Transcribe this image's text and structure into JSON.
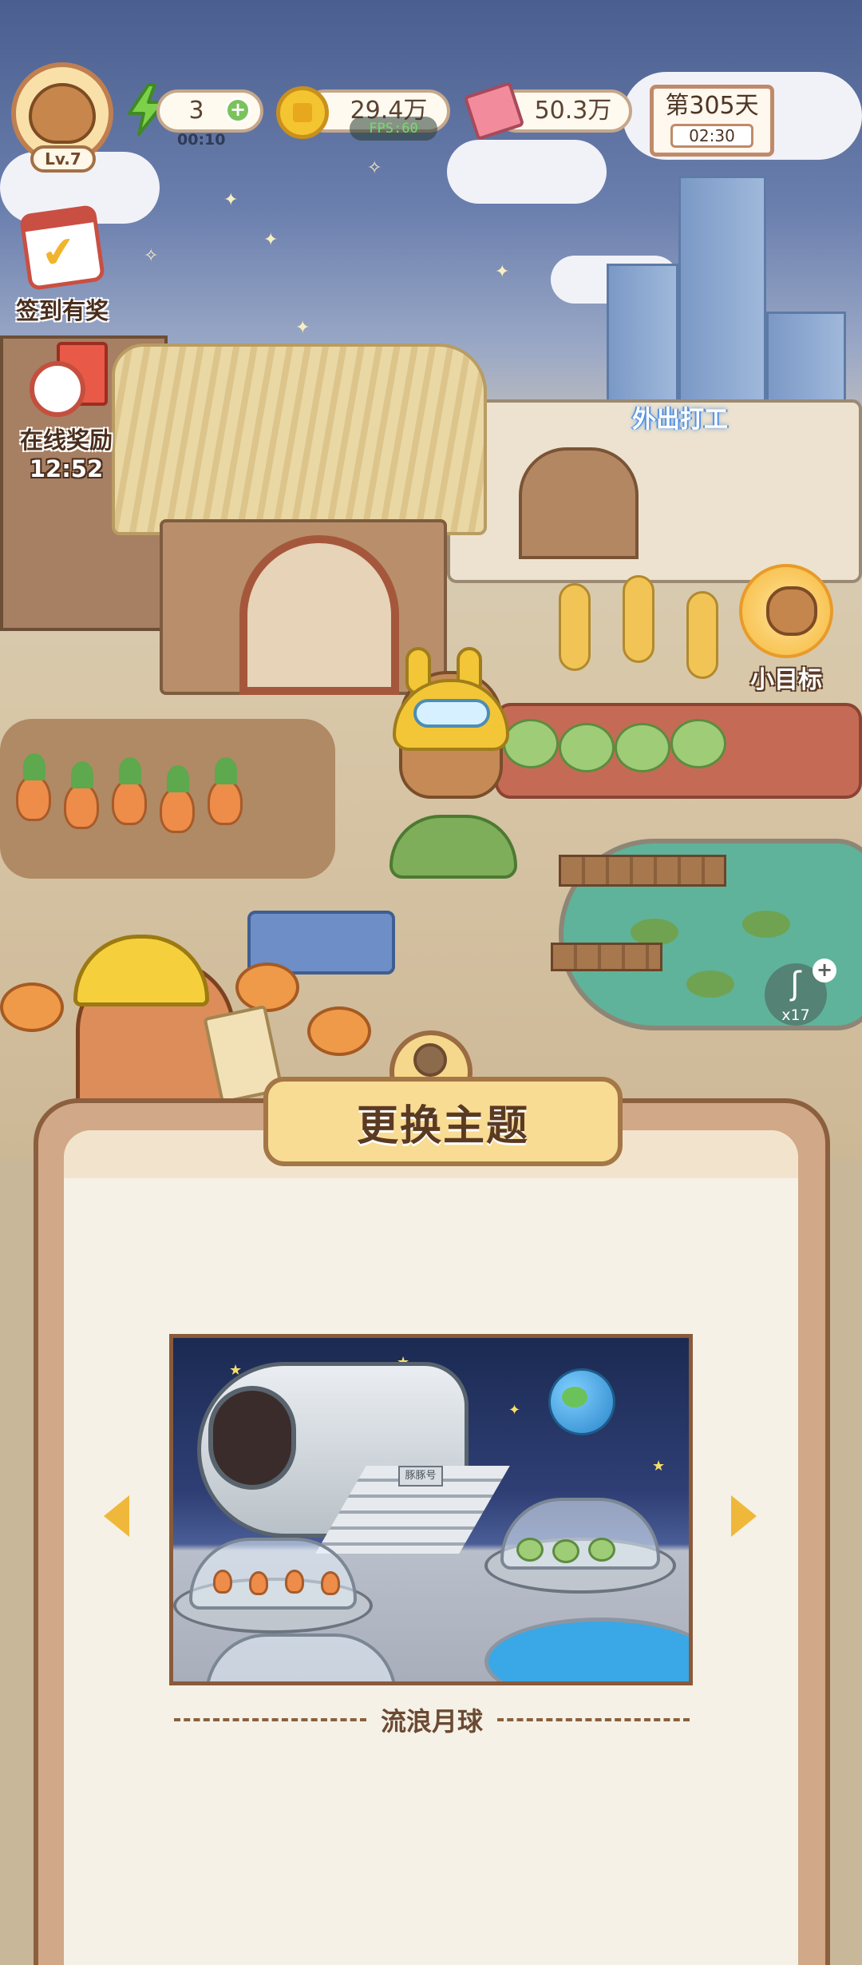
{
  "hud": {
    "level": "Lv.7",
    "energy": "3",
    "energy_timer": "00:10",
    "coins": "29.4万",
    "fps_overlay": "FPS:60",
    "tickets": "50.3万",
    "day": "第305天",
    "clock": "02:30"
  },
  "side_buttons": {
    "checkin_label": "签到有奖",
    "online_reward_label": "在线奖励",
    "online_reward_timer": "12:52"
  },
  "scene": {
    "work_label": "外出打工",
    "goal_label": "小目标",
    "bait_count": "x17"
  },
  "panel": {
    "title": "更换主题",
    "theme_name": "流浪月球",
    "ship_plate": "豚豚号"
  },
  "colors": {
    "panel_border": "#8c5f3f",
    "panel_bg": "#f6f1e6",
    "accent_yellow": "#f0b83a",
    "title_plate": "#f8dc93"
  }
}
